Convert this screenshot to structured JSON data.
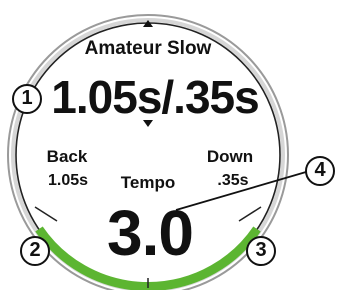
{
  "screen": {
    "preset_name": "Amateur Slow",
    "total_time": "1.05s/.35s",
    "backswing": {
      "label": "Back",
      "value": "1.05s"
    },
    "downswing": {
      "label": "Down",
      "value": ".35s"
    },
    "tempo": {
      "label": "Tempo",
      "value": "3.0"
    }
  },
  "tempo_range_indicator": {
    "colors": {
      "in_range": "#5cb531",
      "bezel": "#9a9a9a",
      "ring": "#d6d6d6"
    }
  },
  "callouts": [
    "1",
    "2",
    "3",
    "4"
  ],
  "icons": {
    "previous": "chevron-up-icon",
    "next": "chevron-down-icon"
  }
}
